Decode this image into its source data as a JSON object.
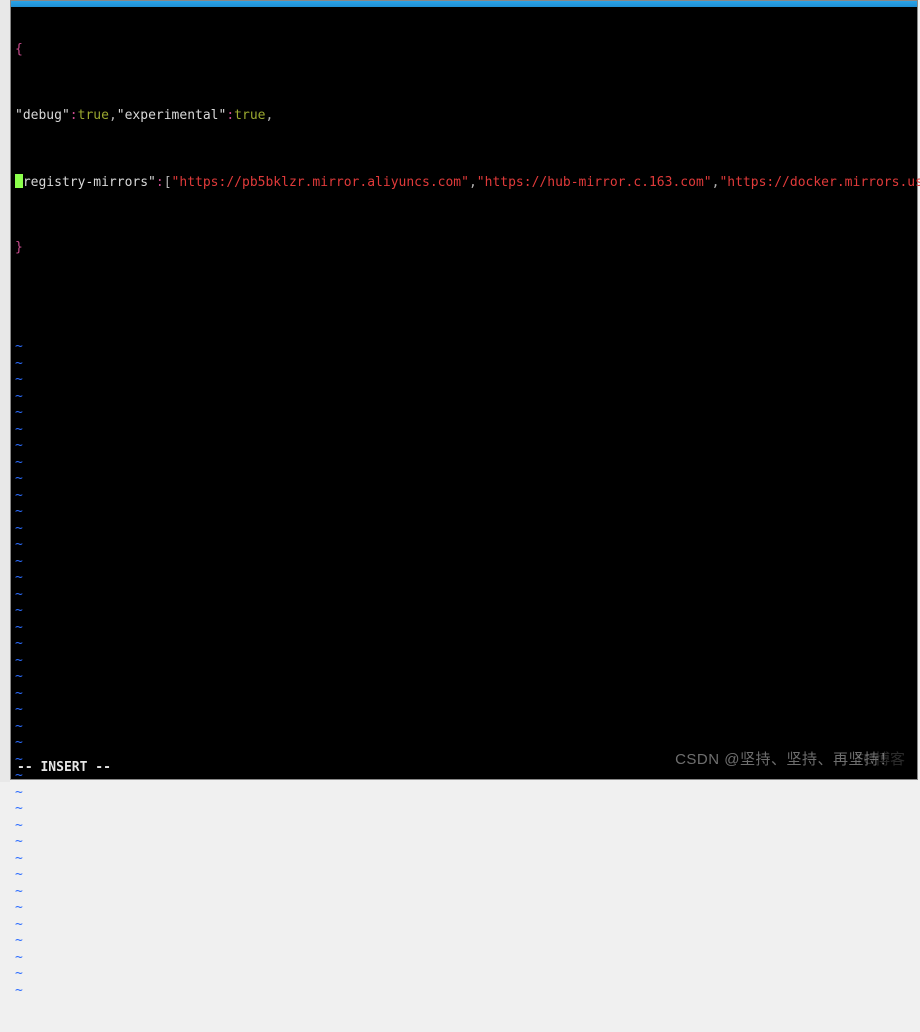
{
  "gutter_chars": [
    "",
    "",
    "",
    "",
    "",
    "",
    "",
    "",
    "",
    "",
    "",
    "",
    "",
    "",
    "",
    "",
    "",
    "",
    "",
    "",
    "",
    "",
    "",
    ""
  ],
  "code": {
    "open_brace": "{",
    "key_debug": "\"debug\"",
    "colon": ":",
    "true": "true",
    "comma": ",",
    "key_experimental": "\"experimental\"",
    "key_registry": "\"registry-mirrors\"",
    "open_bracket": "[",
    "mirror1": "\"https://pb5bklzr.mirror.aliyuncs.com\"",
    "mirror2": "\"https://hub-mirror.c.163.com\"",
    "mirror3": "\"https://docker.mirrors.ustc.edu.cn\"",
    "close_bracket": "]",
    "close_brace": "}"
  },
  "tilde": "~",
  "status": "-- INSERT --",
  "watermark_primary": "CSDN @坚持、坚持、再坚持！",
  "watermark_secondary": "TO博客"
}
